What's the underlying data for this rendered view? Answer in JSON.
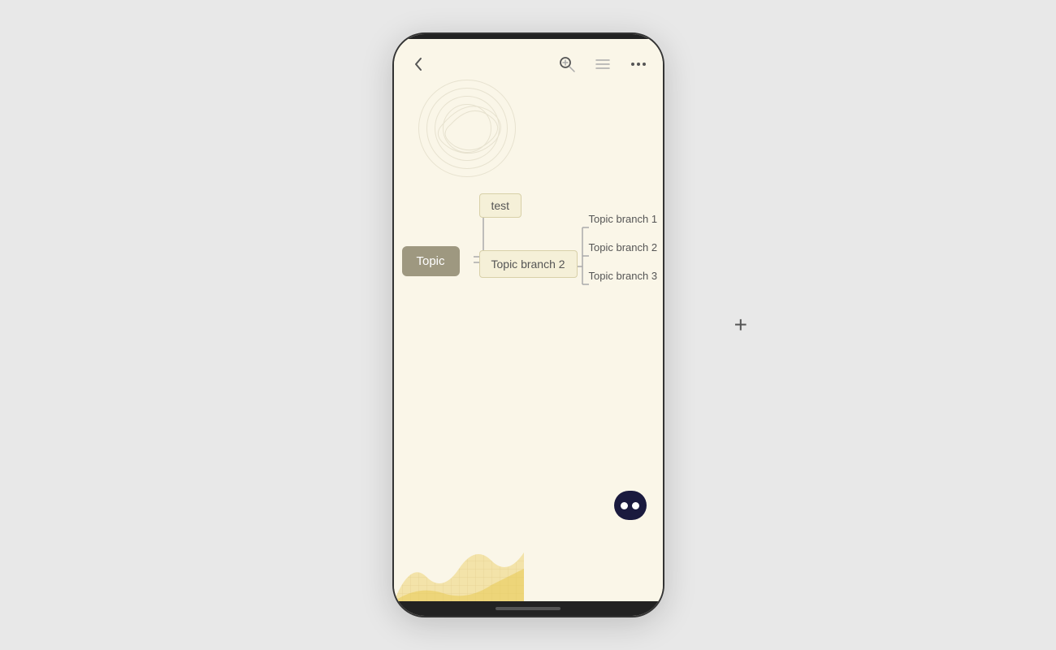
{
  "phone": {
    "background_color": "#faf6e8"
  },
  "toolbar": {
    "back_label": "‹",
    "zoom_icon": "zoom",
    "list_icon": "list",
    "more_icon": "more"
  },
  "mindmap": {
    "root_node": "Topic",
    "branch_test": "test",
    "branch2_label": "Topic branch 2",
    "child_branch1": "Topic branch 1",
    "child_branch2": "Topic branch 2",
    "child_branch3": "Topic branch 3"
  },
  "plus_button": "+",
  "ai_bot": {
    "label": "AI assistant"
  },
  "bottom_indicator": "home indicator"
}
